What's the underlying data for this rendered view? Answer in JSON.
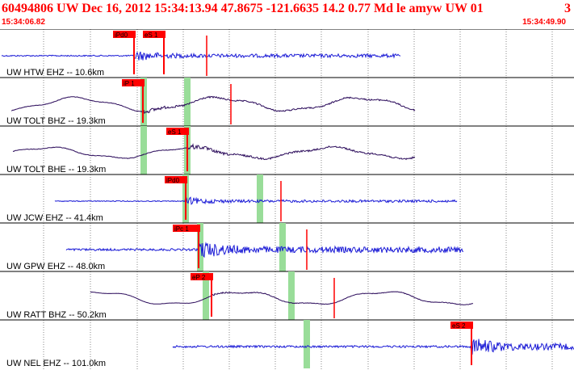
{
  "header": {
    "title": "60494806 UW Dec 16, 2012 15:34:13.94   47.8675 -121.6635 14.2 0.77 Md le amyw UW 01",
    "title_end": "3",
    "start_time": "15:34:06.82",
    "end_time": "15:34:49.90"
  },
  "colors": {
    "header_text": "#ff0000",
    "trace_blue": "#1a1ad6",
    "trace_purple": "#2a0a5a",
    "pick_box": "#ff0000",
    "pick_window": "#99dd99",
    "label_text": "#000000"
  },
  "traces": [
    {
      "label": "UW HTW EHZ -- 10.6km",
      "color": "blue",
      "amp": 0.3,
      "noise": 0.35,
      "picks": [
        "iPd0",
        "eS 1"
      ]
    },
    {
      "label": "UW TOLT BHZ -- 19.3km",
      "color": "purple",
      "amp": 0.55,
      "noise": 0.25,
      "picks": [
        "iP 1"
      ]
    },
    {
      "label": "UW TOLT BHE -- 19.3km",
      "color": "purple",
      "amp": 0.45,
      "noise": 0.3,
      "picks": [
        "eS 1"
      ]
    },
    {
      "label": "UW JCW EHZ -- 41.4km",
      "color": "blue",
      "amp": 0.2,
      "noise": 0.25,
      "picks": [
        "iPd0"
      ]
    },
    {
      "label": "UW GPW EHZ -- 48.0km",
      "color": "blue",
      "amp": 0.55,
      "noise": 0.6,
      "picks": [
        "iPc 1"
      ]
    },
    {
      "label": "UW RATT BHZ -- 50.2km",
      "color": "purple",
      "amp": 0.55,
      "noise": 0.1,
      "picks": [
        "eP 2"
      ]
    },
    {
      "label": "UW NEL EHZ -- 101.0km",
      "color": "blue",
      "amp": 0.5,
      "noise": 0.6,
      "picks": [
        "eS 2"
      ]
    }
  ]
}
